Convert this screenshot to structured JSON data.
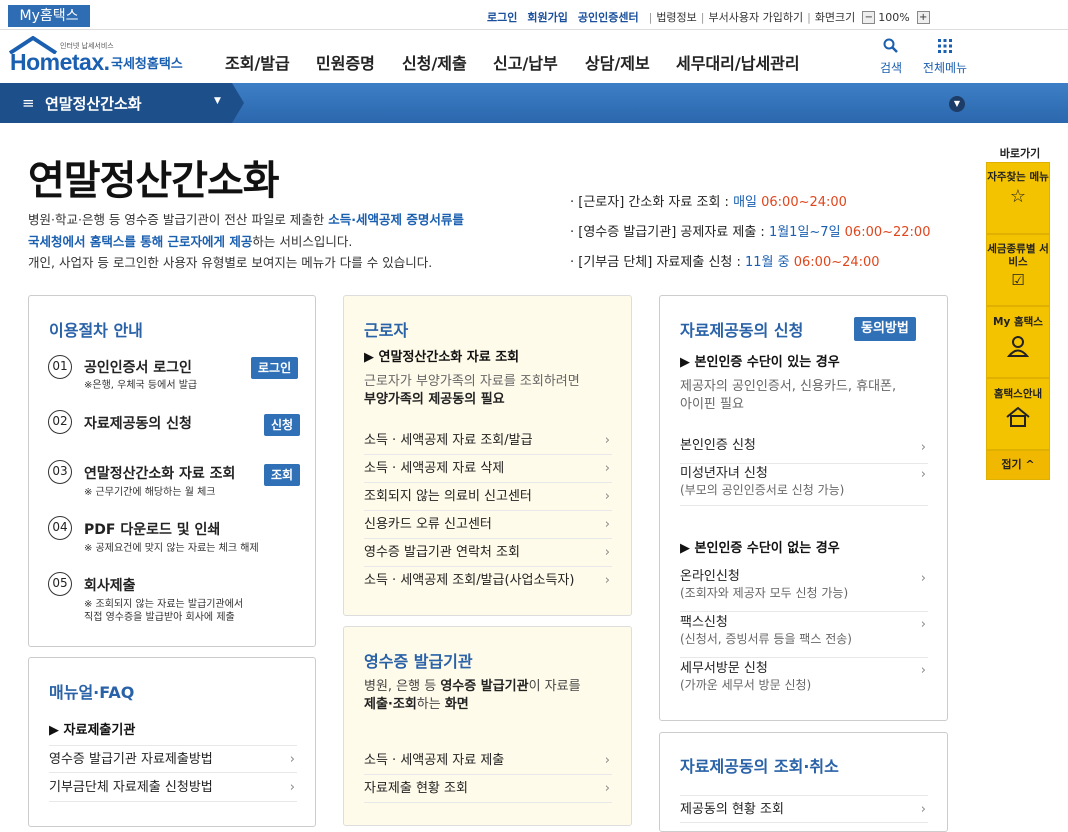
{
  "topbar": {
    "my_home": "My홈택스",
    "login": "로그인",
    "signup": "회원가입",
    "cert_center": "공인인증센터",
    "legal": "법령정보",
    "dept_user": "부서사용자 가입하기",
    "screen_size": "화면크기",
    "zoom": "100%"
  },
  "header": {
    "logo_sub": "인터넷 납세서비스",
    "logo_text": "Hometax.",
    "logo_kor": "국세청홈택스",
    "menu": [
      "조회/발급",
      "민원증명",
      "신청/제출",
      "신고/납부",
      "상담/제보",
      "세무대리/납세관리"
    ],
    "search_label": "검색",
    "all_menu_label": "전체메뉴"
  },
  "navbar": {
    "current": "연말정산간소화"
  },
  "page": {
    "title": "연말정산간소화",
    "desc_line1_a": "병원·학교·은행 등 영수증 발급기관이 전산 파일로 제출한 ",
    "desc_line1_b": "소득·세액공제 증명서류를",
    "desc_line2_a": "국세청에서 홈택스를 통해 근로자에게 제공",
    "desc_line2_b": "하는 서비스입니다.",
    "desc_line3": "개인, 사업자 등 로그인한 사용자 유형별로 보여지는 메뉴가 다를 수 있습니다."
  },
  "schedule": [
    {
      "label": "· [근로자] 간소화 자료 조회 : ",
      "date": "매일 ",
      "time": "06:00~24:00"
    },
    {
      "label": "· [영수증 발급기관] 공제자료 제출 : ",
      "date": "1월1일~7일 ",
      "time": "06:00~22:00"
    },
    {
      "label": "· [기부금 단체] 자료제출 신청 : ",
      "date": "11월 중 ",
      "time": "06:00~24:00"
    }
  ],
  "procedure": {
    "title": "이용절차 안내",
    "steps": [
      {
        "num": "01",
        "label": "공인인증서 로그인",
        "sub": "※은행, 우체국 등에서 발급",
        "sub2": "",
        "badge": "로그인"
      },
      {
        "num": "02",
        "label": "자료제공동의 신청",
        "sub": "",
        "sub2": "",
        "badge": "신청"
      },
      {
        "num": "03",
        "label": "연말정산간소화 자료 조회",
        "sub": "※ 근무기간에 해당하는 월 체크",
        "sub2": "",
        "badge": "조회"
      },
      {
        "num": "04",
        "label": "PDF 다운로드 및 인쇄",
        "sub": "※ 공제요건에 맞지 않는 자료는 체크 해제",
        "sub2": "",
        "badge": ""
      },
      {
        "num": "05",
        "label": "회사제출",
        "sub": "※ 조회되지 않는 자료는 발급기관에서",
        "sub2": "직접 영수증을 발급받아 회사에 제출",
        "badge": ""
      }
    ]
  },
  "worker": {
    "title": "근로자",
    "subhead": "▶ 연말정산간소화 자료 조회",
    "desc1": "근로자가 부양가족의 자료를 조회하려면",
    "desc2": "부양가족의 제공동의 필요",
    "links": [
      "소득 · 세액공제 자료 조회/발급",
      "소득 · 세액공제 자료 삭제",
      "조회되지 않는 의료비 신고센터",
      "신용카드 오류 신고센터",
      "영수증 발급기관 연락처 조회",
      "소득 · 세액공제 조회/발급(사업소득자)"
    ]
  },
  "consent": {
    "title": "자료제공동의 신청",
    "badge": "동의방법",
    "subhead1": "▶ 본인인증 수단이 있는 경우",
    "desc1": "제공자의 공인인증서, 신용카드, 휴대폰,",
    "desc2": "아이핀 필요",
    "links1": [
      {
        "label": "본인인증 신청",
        "sub": ""
      },
      {
        "label": "미성년자녀 신청",
        "sub": "(부모의 공인인증서로 신청 가능)"
      }
    ],
    "subhead2": "▶ 본인인증 수단이 없는 경우",
    "links2": [
      {
        "label": "온라인신청",
        "sub": "(조회자와 제공자 모두 신청 가능)"
      },
      {
        "label": "팩스신청",
        "sub": "(신청서, 증빙서류 등을 팩스 전송)"
      },
      {
        "label": "세무서방문 신청",
        "sub": "(가까운 세무서 방문 신청)"
      }
    ]
  },
  "manual": {
    "title": "매뉴얼·FAQ",
    "subhead": "▶ 자료제출기관",
    "links": [
      "영수증 발급기관 자료제출방법",
      "기부금단체 자료제출 신청방법"
    ]
  },
  "issuer": {
    "title": "영수증 발급기관",
    "desc1_a": "병원, 은행 등 ",
    "desc1_b": "영수증 발급기관",
    "desc1_c": "이 자료를",
    "desc2_a": "제출·조회",
    "desc2_b": "하는 ",
    "desc2_c": "화면",
    "links": [
      "소득 · 세액공제 자료 제출",
      "자료제출 현황 조회"
    ]
  },
  "consent_query": {
    "title": "자료제공동의 조회·취소",
    "links": [
      "제공동의 현황 조회"
    ]
  },
  "quick": {
    "title": "바로가기",
    "items": [
      {
        "label": "자주찾는 메뉴",
        "icon": "star-icon"
      },
      {
        "label": "세금종류별 서비스",
        "icon": "checkbox-icon"
      },
      {
        "label": "My 홈택스",
        "icon": "person-icon"
      },
      {
        "label": "홈택스안내",
        "icon": "house-icon"
      }
    ],
    "collapse": "접기 ^"
  },
  "colors": {
    "brand": "#2e6db4",
    "accent_red": "#e0461d",
    "sidebar": "#f4c300"
  }
}
